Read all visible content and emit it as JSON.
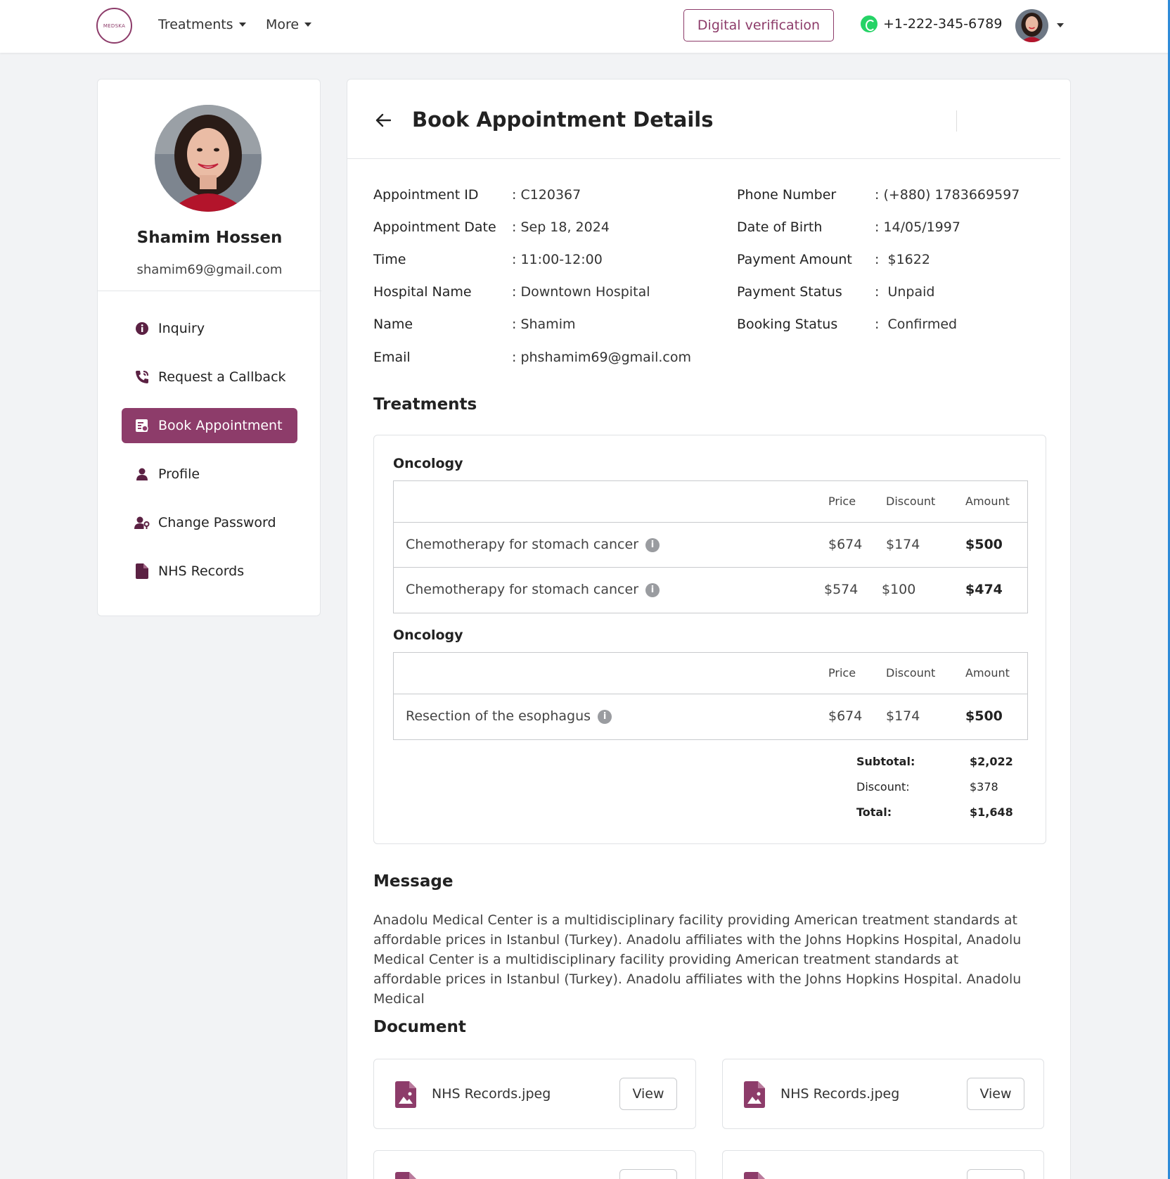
{
  "header": {
    "logo_text": "MEDSKA",
    "nav": [
      {
        "label": "Treatments"
      },
      {
        "label": "More"
      }
    ],
    "verify_button": "Digital verification",
    "phone": "+1-222-345-6789"
  },
  "sidebar": {
    "user_name": "Shamim Hossen",
    "user_email": "shamim69@gmail.com",
    "items": [
      {
        "label": "Inquiry",
        "icon": "info-icon"
      },
      {
        "label": "Request a Callback",
        "icon": "phone-icon"
      },
      {
        "label": "Book Appointment",
        "icon": "appointment-icon",
        "active": true
      },
      {
        "label": "Profile",
        "icon": "user-icon"
      },
      {
        "label": "Change Password",
        "icon": "user-lock-icon"
      },
      {
        "label": "NHS Records",
        "icon": "file-icon"
      }
    ]
  },
  "main": {
    "title": "Book Appointment Details",
    "details_left": [
      {
        "label": "Appointment ID",
        "value": ": C120367"
      },
      {
        "label": "Appointment Date",
        "value": ": Sep 18, 2024"
      },
      {
        "label": "Time",
        "value": ": 11:00-12:00"
      },
      {
        "label": "Hospital Name",
        "value": ": Downtown Hospital"
      },
      {
        "label": "Name",
        "value": ": Shamim"
      },
      {
        "label": "Email",
        "value": ": phshamim69@gmail.com"
      }
    ],
    "details_right": [
      {
        "label": "Phone Number",
        "value": ": (+880) 1783669597"
      },
      {
        "label": "Date of Birth",
        "value": ": 14/05/1997"
      },
      {
        "label": "Payment Amount",
        "value": ":  $1622"
      },
      {
        "label": "Payment Status",
        "value": ":  Unpaid"
      },
      {
        "label": "Booking Status",
        "value": ":  Confirmed"
      }
    ],
    "treatments_heading": "Treatments",
    "table_headers": {
      "price": "Price",
      "discount": "Discount",
      "amount": "Amount"
    },
    "groups": [
      {
        "title": "Oncology",
        "rows": [
          {
            "name": "Chemotherapy for stomach cancer",
            "price": "$674",
            "discount": "$174",
            "amount": "$500"
          },
          {
            "name": "Chemotherapy for stomach cancer",
            "price": "$574",
            "discount": "$100",
            "amount": "$474"
          }
        ]
      },
      {
        "title": "Oncology",
        "rows": [
          {
            "name": "Resection of the esophagus",
            "price": "$674",
            "discount": "$174",
            "amount": "$500"
          }
        ]
      }
    ],
    "summary": {
      "subtotal_label": "Subtotal:",
      "subtotal": "$2,022",
      "discount_label": "Discount:",
      "discount": "$378",
      "total_label": "Total:",
      "total": "$1,648"
    },
    "message_heading": "Message",
    "message": "Anadolu Medical Center is a multidisciplinary facility providing American treatment standards at affordable prices in Istanbul (Turkey). Anadolu affiliates with the Johns Hopkins Hospital, Anadolu Medical Center is a multidisciplinary facility providing American treatment standards at affordable prices in Istanbul (Turkey). Anadolu affiliates with the Johns Hopkins Hospital. Anadolu Medical",
    "document_heading": "Document",
    "documents": [
      {
        "name": "NHS Records.jpeg",
        "action": "View"
      },
      {
        "name": "NHS Records.jpeg",
        "action": "View"
      }
    ]
  },
  "colors": {
    "accent": "#8d3c6a",
    "whatsapp": "#25d366"
  }
}
